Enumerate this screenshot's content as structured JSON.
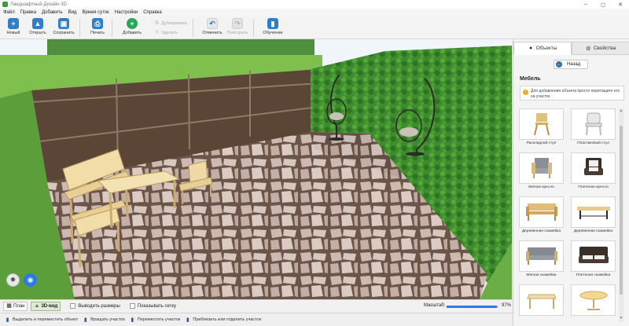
{
  "window": {
    "title": "Ландшафтный Дизайн 3D"
  },
  "menu": [
    "Файл",
    "Правка",
    "Добавить",
    "Вид",
    "Время суток",
    "Настройки",
    "Справка"
  ],
  "toolbar": {
    "new": "Новый",
    "open": "Открыть",
    "save": "Сохранить",
    "print": "Печать",
    "add": "Добавить",
    "duplicate": "Дублировать",
    "delete": "Удалить",
    "undo": "Отменить",
    "redo": "Повторить",
    "learn": "Обучение"
  },
  "panel": {
    "tab_objects": "Объекты",
    "tab_properties": "Свойства",
    "back": "Назад",
    "section": "Мебель",
    "hint": "Для добавления объекта просто перетащите его на участок",
    "items": [
      {
        "label": "Раскладной стул",
        "icon": "folding-chair"
      },
      {
        "label": "Пластиковый стул",
        "icon": "plastic-chair"
      },
      {
        "label": "Мягкое кресло",
        "icon": "soft-armchair"
      },
      {
        "label": "Плетеное кресло",
        "icon": "wicker-armchair"
      },
      {
        "label": "Деревянная скамейка",
        "icon": "wooden-bench"
      },
      {
        "label": "Деревянная скамейка",
        "icon": "wooden-bench-2"
      },
      {
        "label": "Мягкая скамейка",
        "icon": "soft-bench"
      },
      {
        "label": "Плетеная скамейка",
        "icon": "wicker-bench"
      },
      {
        "label": "",
        "icon": "wooden-table"
      },
      {
        "label": "",
        "icon": "round-table"
      }
    ]
  },
  "viewbar": {
    "plan": "План",
    "view3d": "3D-вид",
    "show_sizes": "Выводить размеры",
    "show_grid": "Показывать сетку",
    "zoom_label": "Масштаб:",
    "zoom_value": "97%",
    "zoom_fraction": 0.97
  },
  "status": [
    "Выделить и переместить объект",
    "Вращать участок",
    "Переместить участок",
    "Приблизить или отдалить участок"
  ],
  "colors": {
    "accent": "#2c7be5",
    "grass": "#5fa43a",
    "hedge": "#3c8a2c",
    "fence": "#5a4536",
    "wood": "#f0d9a4"
  }
}
